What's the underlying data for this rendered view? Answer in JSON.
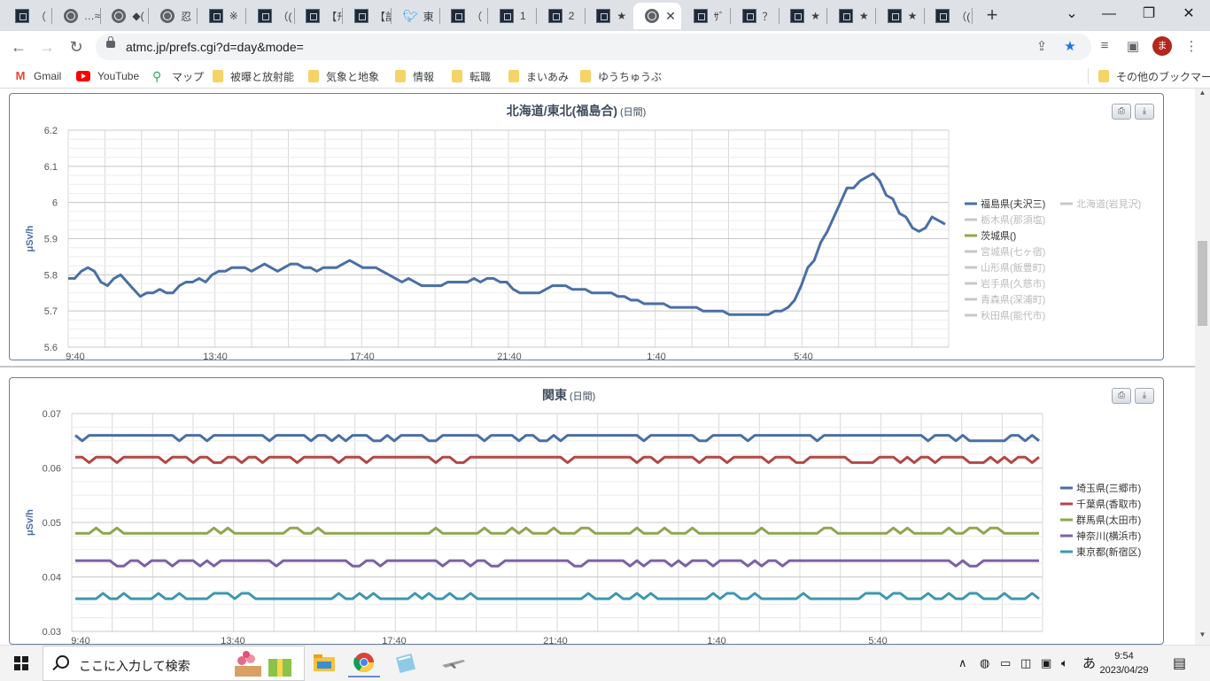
{
  "browser": {
    "tabs": [
      {
        "icon": "site-icon",
        "title": "（"
      },
      {
        "icon": "globe-icon",
        "title": "…≈"
      },
      {
        "icon": "globe-icon",
        "title": "◆("
      },
      {
        "icon": "globe-icon",
        "title": "忍"
      },
      {
        "icon": "site-icon",
        "title": "※"
      },
      {
        "icon": "site-icon",
        "title": "（("
      },
      {
        "icon": "site-icon",
        "title": "【ﾁ"
      },
      {
        "icon": "site-icon",
        "title": "【訁"
      },
      {
        "icon": "twitter-icon",
        "title": "東"
      },
      {
        "icon": "site-icon",
        "title": "（"
      },
      {
        "icon": "site-icon",
        "title": "1"
      },
      {
        "icon": "site-icon",
        "title": "2"
      },
      {
        "icon": "site-icon",
        "title": "★"
      },
      {
        "icon": "globe-icon",
        "title": "",
        "active": true
      },
      {
        "icon": "site-icon",
        "title": "ｻﾞ"
      },
      {
        "icon": "site-icon",
        "title": "？"
      },
      {
        "icon": "site-icon",
        "title": "★"
      },
      {
        "icon": "site-icon",
        "title": "★"
      },
      {
        "icon": "site-icon",
        "title": "★"
      },
      {
        "icon": "site-icon",
        "title": "（("
      }
    ],
    "url": "atmc.jp/prefs.cgi?d=day&mode=",
    "avatar_letter": "ま",
    "bookmarks": [
      {
        "icon": "gmail-icon",
        "label": "Gmail"
      },
      {
        "icon": "youtube-icon",
        "label": "YouTube"
      },
      {
        "icon": "maps-icon",
        "label": "マップ"
      },
      {
        "icon": "folder-icon",
        "label": "被曝と放射能"
      },
      {
        "icon": "folder-icon",
        "label": "気象と地象"
      },
      {
        "icon": "folder-icon",
        "label": "情報"
      },
      {
        "icon": "folder-icon",
        "label": "転職"
      },
      {
        "icon": "folder-icon",
        "label": "まいあみ"
      },
      {
        "icon": "folder-icon",
        "label": "ゆうちゅうぶ"
      }
    ],
    "other_bookmarks": "その他のブックマーク"
  },
  "chart_data": [
    {
      "type": "line",
      "title": "北海道/東北(福島合)",
      "subtitle": "(日間)",
      "ylabel": "μSv/h",
      "ylim": [
        5.6,
        6.2
      ],
      "yticks": [
        "6.2",
        "6.1",
        "6",
        "5.9",
        "5.8",
        "5.7",
        "5.6"
      ],
      "xticks": [
        "9:40",
        "13:40",
        "17:40",
        "21:40",
        "1:40",
        "5:40"
      ],
      "legend_position": "right",
      "series": [
        {
          "name": "福島県(夫沢三)",
          "color": "#4a6fa5",
          "visible": true,
          "values": [
            5.79,
            5.79,
            5.81,
            5.82,
            5.81,
            5.78,
            5.77,
            5.79,
            5.8,
            5.78,
            5.76,
            5.74,
            5.75,
            5.75,
            5.76,
            5.75,
            5.75,
            5.77,
            5.78,
            5.78,
            5.79,
            5.78,
            5.8,
            5.81,
            5.81,
            5.82,
            5.82,
            5.82,
            5.81,
            5.82,
            5.83,
            5.82,
            5.81,
            5.82,
            5.83,
            5.83,
            5.82,
            5.82,
            5.81,
            5.82,
            5.82,
            5.82,
            5.83,
            5.84,
            5.83,
            5.82,
            5.82,
            5.82,
            5.81,
            5.8,
            5.79,
            5.78,
            5.79,
            5.78,
            5.77,
            5.77,
            5.77,
            5.77,
            5.78,
            5.78,
            5.78,
            5.78,
            5.79,
            5.78,
            5.79,
            5.79,
            5.78,
            5.78,
            5.76,
            5.75,
            5.75,
            5.75,
            5.75,
            5.76,
            5.77,
            5.77,
            5.77,
            5.76,
            5.76,
            5.76,
            5.75,
            5.75,
            5.75,
            5.75,
            5.74,
            5.74,
            5.73,
            5.73,
            5.72,
            5.72,
            5.72,
            5.72,
            5.71,
            5.71,
            5.71,
            5.71,
            5.71,
            5.7,
            5.7,
            5.7,
            5.7,
            5.69,
            5.69,
            5.69,
            5.69,
            5.69,
            5.69,
            5.69,
            5.7,
            5.7,
            5.71,
            5.73,
            5.77,
            5.82,
            5.84,
            5.89,
            5.92,
            5.96,
            6.0,
            6.04,
            6.04,
            6.06,
            6.07,
            6.08,
            6.06,
            6.02,
            6.01,
            5.97,
            5.96,
            5.93,
            5.92,
            5.93,
            5.96,
            5.95,
            5.94
          ]
        },
        {
          "name": "北海道(岩見沢)",
          "color": "#c8c8c8",
          "visible": false
        },
        {
          "name": "栃木県(那須塩)",
          "color": "#c8c8c8",
          "visible": false
        },
        {
          "name": "茨城県()",
          "color": "#8fa64f",
          "visible": true
        },
        {
          "name": "宮城県(七ヶ宿)",
          "color": "#c8c8c8",
          "visible": false
        },
        {
          "name": "山形県(飯豊町)",
          "color": "#c8c8c8",
          "visible": false
        },
        {
          "name": "岩手県(久慈市)",
          "color": "#c8c8c8",
          "visible": false
        },
        {
          "name": "青森県(深浦町)",
          "color": "#c8c8c8",
          "visible": false
        },
        {
          "name": "秋田県(能代市)",
          "color": "#c8c8c8",
          "visible": false
        }
      ]
    },
    {
      "type": "line",
      "title": "関東",
      "subtitle": "(日間)",
      "ylabel": "μSv/h",
      "ylim": [
        0.03,
        0.07
      ],
      "yticks": [
        "0.07",
        "0.06",
        "0.05",
        "0.04",
        "0.03"
      ],
      "xticks": [
        "9:40",
        "13:40",
        "17:40",
        "21:40",
        "1:40",
        "5:40"
      ],
      "legend_position": "right",
      "series": [
        {
          "name": "埼玉県(三郷市)",
          "color": "#4a6fa5",
          "visible": true,
          "base": 0.066,
          "alt": 0.065,
          "seed": 3
        },
        {
          "name": "千葉県(香取市)",
          "color": "#b34747",
          "visible": true,
          "base": 0.062,
          "alt": 0.061,
          "seed": 7
        },
        {
          "name": "群馬県(太田市)",
          "color": "#8fa64f",
          "visible": true,
          "base": 0.048,
          "alt": 0.049,
          "seed": 11
        },
        {
          "name": "神奈川(横浜市)",
          "color": "#7b62a3",
          "visible": true,
          "base": 0.043,
          "alt": 0.042,
          "seed": 5
        },
        {
          "name": "東京都(新宿区)",
          "color": "#3d97b0",
          "visible": true,
          "base": 0.036,
          "alt": 0.037,
          "seed": 13
        }
      ]
    }
  ],
  "taskbar": {
    "search_placeholder": "ここに入力して検索",
    "ime": "あ",
    "time": "9:54",
    "date": "2023/04/29"
  }
}
